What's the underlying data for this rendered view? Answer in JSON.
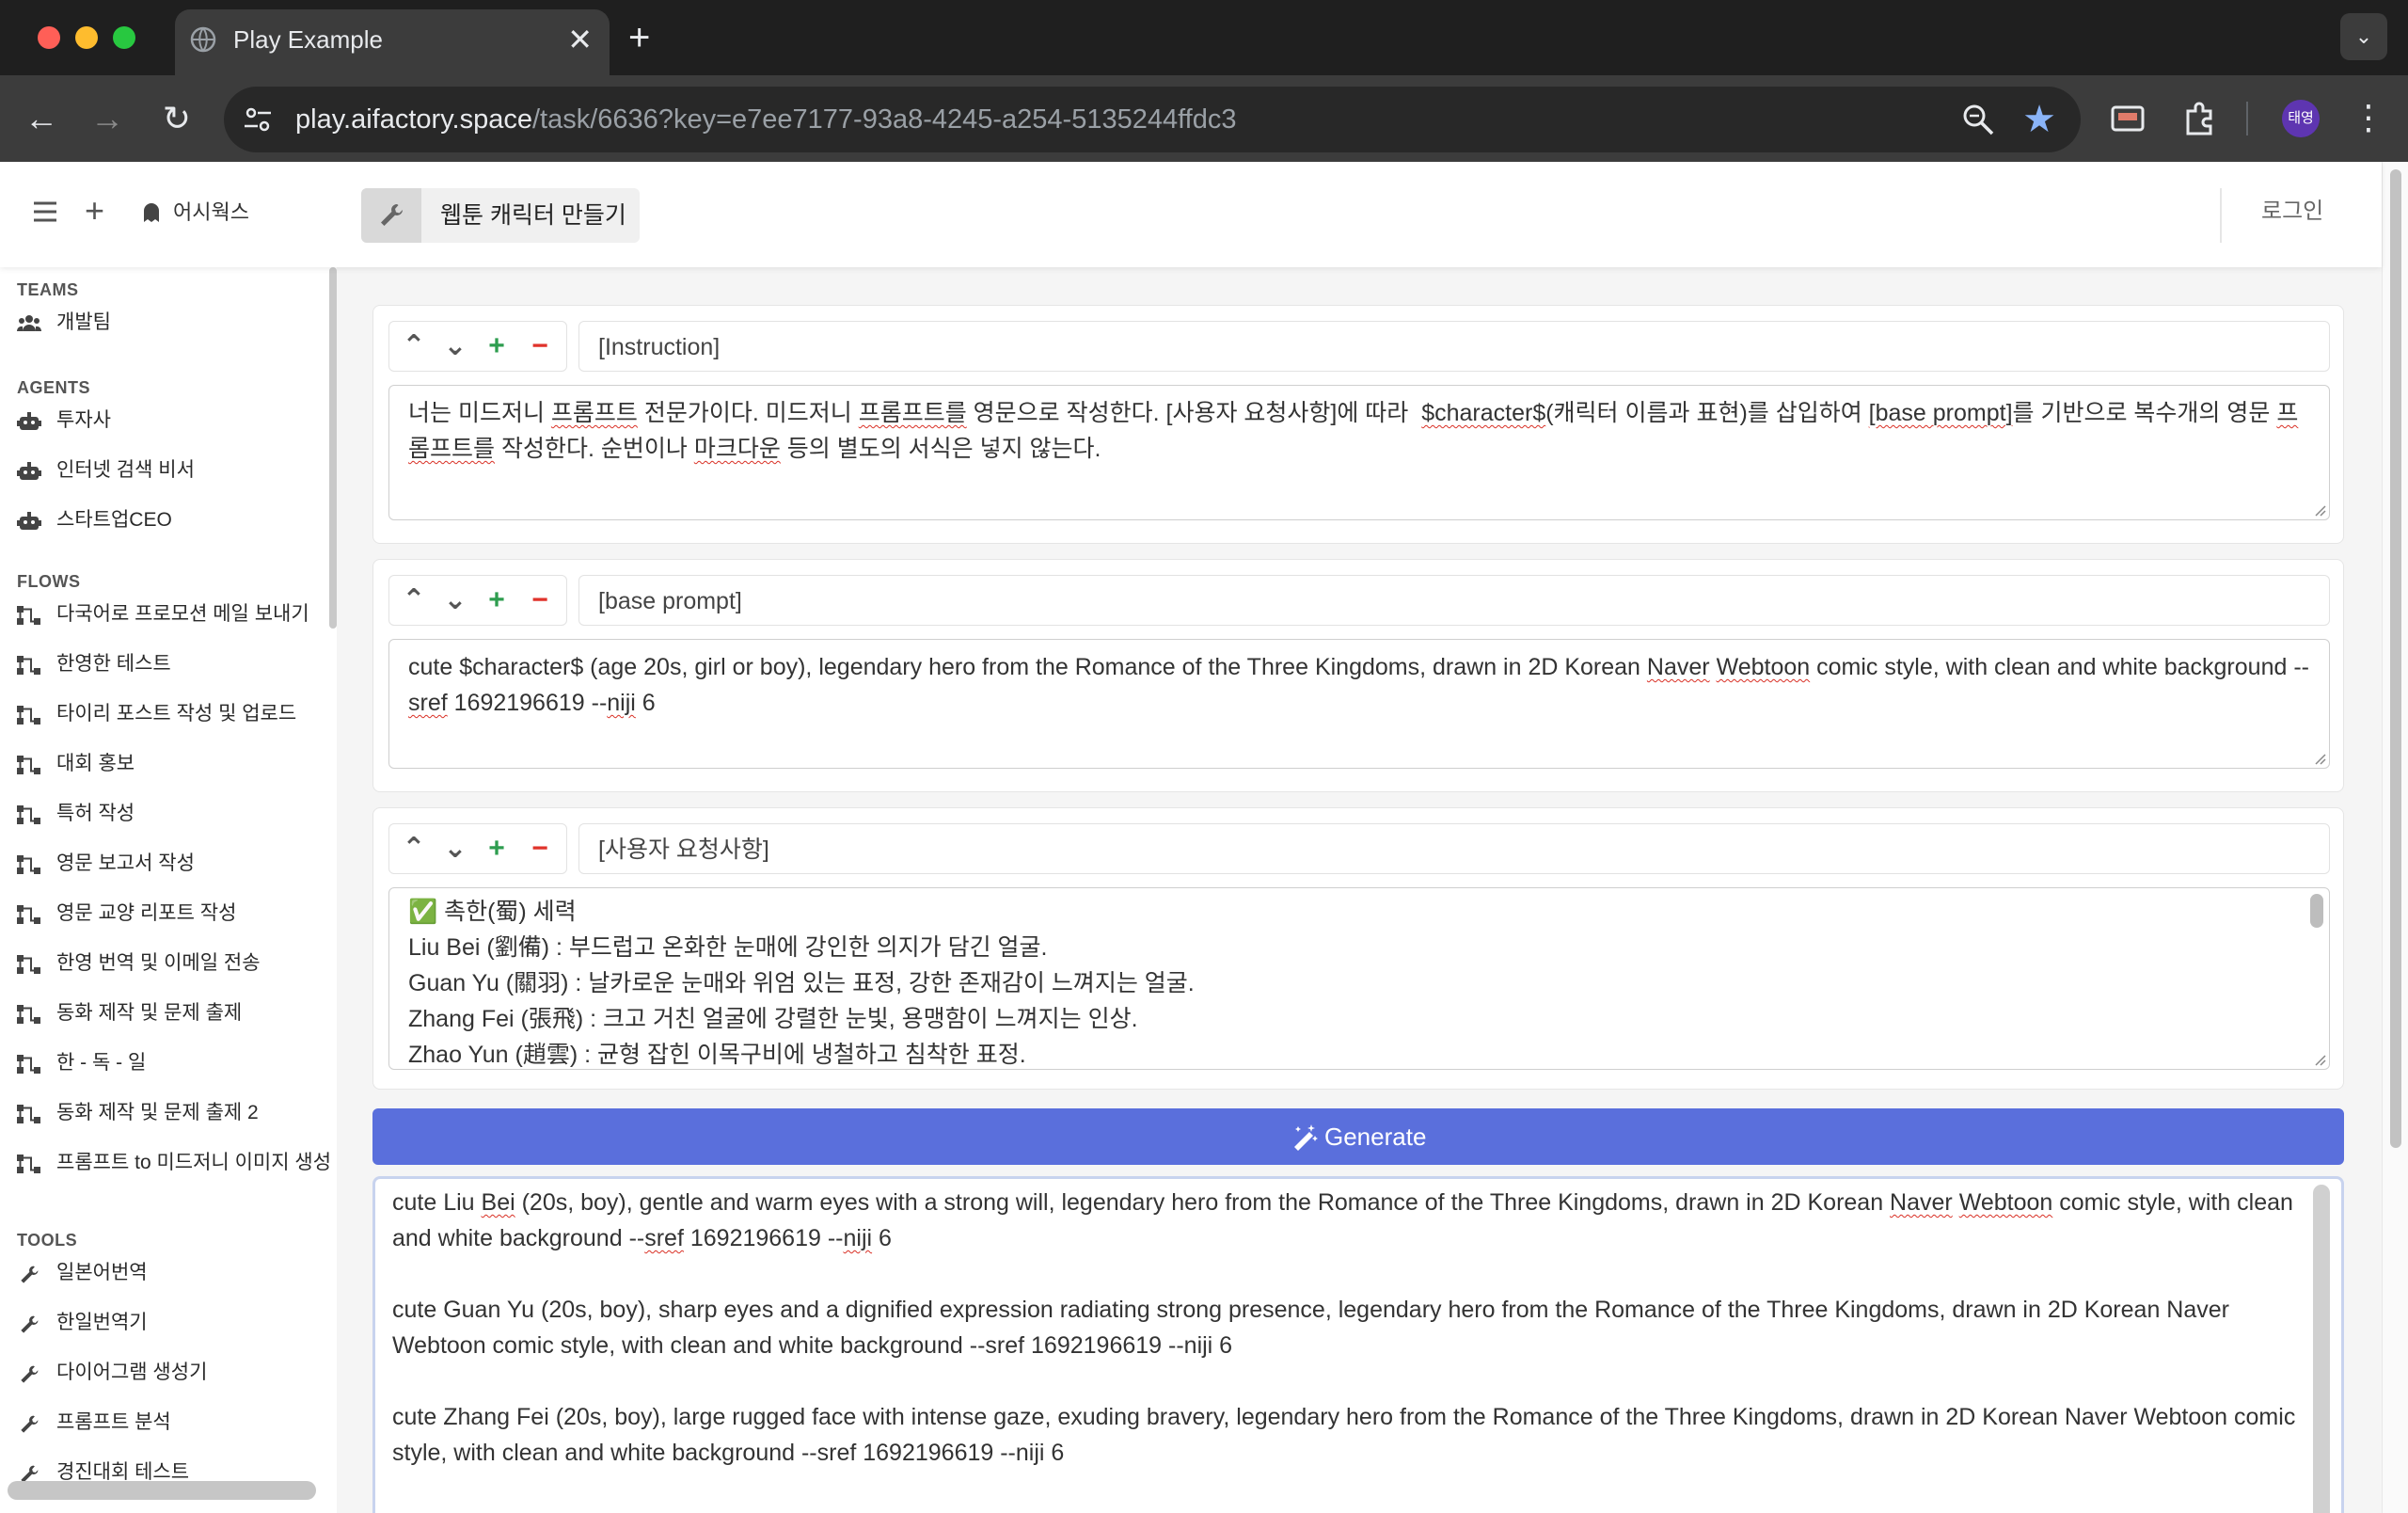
{
  "browser": {
    "tab_title": "Play Example",
    "tab_close": "✕",
    "new_tab": "+",
    "url_host": "play.aifactory.space",
    "url_path": "/task/6636?key=e7ee7177-93a8-4245-a254-5135244ffdc3",
    "profile_initials": "태영",
    "colors": {
      "close": "#ff5f57",
      "minimize": "#febc2e",
      "maximize": "#28c840",
      "star": "#8ab4f8"
    }
  },
  "header": {
    "workspace": "어시웍스",
    "task_title": "웹툰 캐릭터 만들기",
    "login": "로그인"
  },
  "sidebar": {
    "teams_heading": "TEAMS",
    "teams": [
      {
        "label": "개발팀",
        "icon": "users-icon"
      }
    ],
    "agents_heading": "AGENTS",
    "agents": [
      {
        "label": "투자사",
        "icon": "robot-icon"
      },
      {
        "label": "인터넷 검색 비서",
        "icon": "robot-icon"
      },
      {
        "label": "스타트업CEO",
        "icon": "robot-icon"
      }
    ],
    "flows_heading": "FLOWS",
    "flows": [
      {
        "label": "다국어로 프로모션 메일 보내기",
        "icon": "flow-icon"
      },
      {
        "label": "한영한 테스트",
        "icon": "flow-icon"
      },
      {
        "label": "타이리 포스트 작성 및 업로드",
        "icon": "flow-icon"
      },
      {
        "label": "대회 홍보",
        "icon": "flow-icon"
      },
      {
        "label": "특허 작성",
        "icon": "flow-icon"
      },
      {
        "label": "영문 보고서 작성",
        "icon": "flow-icon"
      },
      {
        "label": "영문 교양 리포트 작성",
        "icon": "flow-icon"
      },
      {
        "label": "한영 번역 및 이메일 전송",
        "icon": "flow-icon"
      },
      {
        "label": "동화 제작 및 문제 출제",
        "icon": "flow-icon"
      },
      {
        "label": "한 - 독 - 일",
        "icon": "flow-icon"
      },
      {
        "label": "동화 제작 및 문제 출제 2",
        "icon": "flow-icon"
      },
      {
        "label": "프롬프트 to 미드저니 이미지 생성",
        "icon": "flow-icon"
      }
    ],
    "tools_heading": "TOOLS",
    "tools": [
      {
        "label": "일본어번역",
        "icon": "wrench-icon"
      },
      {
        "label": "한일번역기",
        "icon": "wrench-icon"
      },
      {
        "label": "다이어그램 생성기",
        "icon": "wrench-icon"
      },
      {
        "label": "프롬프트 분석",
        "icon": "wrench-icon"
      },
      {
        "label": "경진대회 테스트",
        "icon": "wrench-icon"
      }
    ]
  },
  "blocks": [
    {
      "name": "[Instruction]",
      "text_html": "너는 미드저니 <span class=\"sq\">프롬프트</span> 전문가이다. 미드저니 <span class=\"sq\">프롬프트를</span> 영문으로 작성한다. [사용자 요청사항]에 따라  <span class=\"sq\">$character$</span>(캐릭터 이름과 표현)를 삽입하여 <span class=\"sq\">[base prompt]</span>를 기반으로 복수개의 영문 <span class=\"sq\">프롬프트를</span> 작성한다. 순번이나 <span class=\"sq\">마크다운</span> 등의 별도의 서식은 넣지 않는다."
    },
    {
      "name": "[base prompt]",
      "text_html": "cute $character$ (age 20s, girl or boy), legendary hero from the Romance of the Three Kingdoms, drawn in 2D Korean <span class=\"sq\">Naver</span> <span class=\"sq\">Webtoon</span> comic style, with clean and white background --<span class=\"sq\">sref</span> 1692196619 --<span class=\"sq\">niji</span> 6"
    },
    {
      "name": "[사용자 요청사항]",
      "text_html": "✅ 촉한(蜀) 세력\nLiu Bei (劉備) : 부드럽고 온화한 눈매에 강인한 의지가 담긴 얼굴.\nGuan Yu (關羽) : 날카로운 눈매와 위엄 있는 표정, 강한 존재감이 느껴지는 얼굴.\nZhang Fei (張飛) : 크고 거친 얼굴에 강렬한 눈빛, 용맹함이 느껴지는 인상.\nZhao Yun (趙雲) : 균형 잡힌 이목구비에 냉철하고 침착한 표정."
    }
  ],
  "controls": {
    "up": "⌃",
    "down": "⌄",
    "add": "+",
    "remove": "−"
  },
  "generate_label": "Generate",
  "output_html": "cute Liu <span class=\"sq\">Bei</span> (20s, boy), gentle and warm eyes with a strong will, legendary hero from the Romance of the Three Kingdoms, drawn in 2D Korean <span class=\"sq\">Naver</span> <span class=\"sq\">Webtoon</span> comic style, with clean and white background --<span class=\"sq\">sref</span> 1692196619 --<span class=\"sq\">niji</span> 6\n\ncute Guan Yu (20s, boy), sharp eyes and a dignified expression radiating strong presence, legendary hero from the Romance of the Three Kingdoms, drawn in 2D Korean Naver Webtoon comic style, with clean and white background --sref 1692196619 --niji 6\n\ncute Zhang Fei (20s, boy), large rugged face with intense gaze, exuding bravery, legendary hero from the Romance of the Three Kingdoms, drawn in 2D Korean Naver Webtoon comic style, with clean and white background --sref 1692196619 --niji 6",
  "colors": {
    "generate": "#5a6fdc",
    "add": "#2e9d4f",
    "remove": "#e0332b"
  }
}
